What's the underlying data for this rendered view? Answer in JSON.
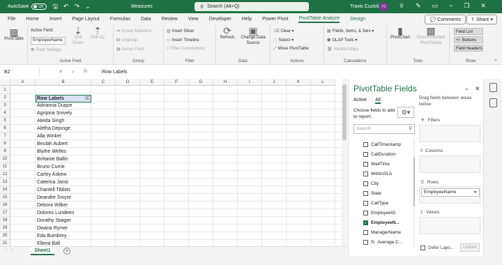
{
  "titlebar": {
    "autosave_label": "AutoSave",
    "autosave_state": "Off",
    "filename": "Measures",
    "search_placeholder": "Search (Alt+Q)",
    "user": "Travis Cuzick",
    "user_initials": "TC"
  },
  "menu": {
    "tabs": [
      "File",
      "Home",
      "Insert",
      "Page Layout",
      "Formulas",
      "Data",
      "Review",
      "View",
      "Developer",
      "Help",
      "Power Pivot",
      "PivotTable Analyze",
      "Design"
    ],
    "active_tab": "PivotTable Analyze",
    "comments": "Comments",
    "share": "Share"
  },
  "ribbon": {
    "pivottable": "PivotTable",
    "active_field_label": "Active Field:",
    "active_field_value": "EmployeeName",
    "field_settings": "Field Settings",
    "drill_down": "Drill Down",
    "drill_up": "Drill Up",
    "group_active_field": "Active Field",
    "group_selection": "Group Selection",
    "ungroup": "Ungroup",
    "group_field": "Group Field",
    "group_group": "Group",
    "insert_slicer": "Insert Slicer",
    "insert_timeline": "Insert Timeline",
    "filter_connections": "Filter Connections",
    "group_filter": "Filter",
    "refresh": "Refresh",
    "change_data_source": "Change Data Source",
    "group_data": "Data",
    "clear": "Clear",
    "select": "Select",
    "move_pivottable": "Move PivotTable",
    "group_actions": "Actions",
    "fields_items_sets": "Fields, Items, & Sets",
    "olap_tools": "OLAP Tools",
    "relationships": "Relationships",
    "group_calculations": "Calculations",
    "pivotchart": "PivotChart",
    "recommended_pivottables": "Recommended PivotTables",
    "group_tools": "Tools",
    "field_list": "Field List",
    "buttons": "+/- Buttons",
    "field_headers": "Field Headers",
    "group_show": "Show"
  },
  "formula_bar": {
    "name_box": "B2",
    "formula": "Row Labels"
  },
  "sheet": {
    "columns": [
      "A",
      "B",
      "C",
      "D",
      "E",
      "F",
      "G",
      "H",
      "I",
      "J",
      "K",
      "L"
    ],
    "rows": [
      "1",
      "2",
      "3",
      "4",
      "5",
      "6",
      "7",
      "8",
      "9",
      "10",
      "11",
      "12",
      "13",
      "14",
      "15",
      "16",
      "17",
      "18",
      "19",
      "20",
      "21",
      "22"
    ],
    "row_labels_header": "Row Labels",
    "names": [
      "Adrianna Duque",
      "Agripina Snively",
      "Aleida Singh",
      "Aletha Dejonge",
      "Alla Winkel",
      "Beulah Aubert",
      "Blythe Welles",
      "Brittanie Ballin",
      "Bruno Currie",
      "Carley Askew",
      "Caterina Jantz",
      "Chantell Tibbits",
      "Deandre Smyre",
      "Debora Wilker",
      "Dolores Lundeen",
      "Dorathy Staiger",
      "Dwana Rymer",
      "Eda Bumbrey",
      "Ellena Ball"
    ],
    "sheet_tab": "Sheet1"
  },
  "pane": {
    "title": "PivotTable Fields",
    "tab_active": "Active",
    "tab_all": "All",
    "choose_fields": "Choose fields to add to report:",
    "drag_fields": "Drag fields between areas below:",
    "search_placeholder": "Search",
    "fields": [
      {
        "name": "CallTimestamp",
        "checked": false,
        "fx": false
      },
      {
        "name": "CallDuration",
        "checked": false,
        "fx": false
      },
      {
        "name": "WaitTime",
        "checked": false,
        "fx": false
      },
      {
        "name": "WithinSLA",
        "checked": false,
        "fx": false
      },
      {
        "name": "City",
        "checked": false,
        "fx": false
      },
      {
        "name": "State",
        "checked": false,
        "fx": false
      },
      {
        "name": "CallType",
        "checked": false,
        "fx": false
      },
      {
        "name": "EmployeeID",
        "checked": false,
        "fx": false
      },
      {
        "name": "EmployeeN...",
        "checked": true,
        "fx": false
      },
      {
        "name": "ManagerName",
        "checked": false,
        "fx": false
      },
      {
        "name": "Average C...",
        "checked": false,
        "fx": true
      }
    ],
    "filters": "Filters",
    "columns": "Columns",
    "rows": "Rows",
    "rows_field": "EmployeeName",
    "values": "Values",
    "defer_layout": "Defer Layo...",
    "update": "Update"
  }
}
